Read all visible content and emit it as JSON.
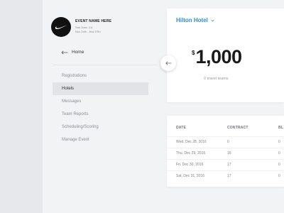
{
  "event": {
    "name": "EVENT NAME HERE",
    "location": "San Jose, CA",
    "dates": "Nov 24th - Nov 27th",
    "logo": "nike-swoosh-logo"
  },
  "sidebar": {
    "home_label": "Home",
    "items": [
      {
        "label": "Registrations",
        "active": false
      },
      {
        "label": "Hotels",
        "active": true
      },
      {
        "label": "Messages",
        "active": false
      },
      {
        "label": "Team Reports",
        "active": false
      },
      {
        "label": "Scheduling/Scoring",
        "active": false
      },
      {
        "label": "Manage Event",
        "active": false
      }
    ]
  },
  "hotel": {
    "name": "Hilton Hotel",
    "currency": "$",
    "amount": "1,000",
    "subtitle": "0 travel teams"
  },
  "table": {
    "columns": [
      "DATE",
      "CONTRACT",
      "BL"
    ],
    "rows": [
      {
        "date": "Wed, Dec 28, 2016",
        "contract": "0",
        "bl": "0"
      },
      {
        "date": "Thu, Dec 29, 2016",
        "contract": "16",
        "bl": "0"
      },
      {
        "date": "Fri, Dec 30, 2016",
        "contract": "17",
        "bl": "0"
      },
      {
        "date": "Sat, Dec 31, 2016",
        "contract": "17",
        "bl": "0"
      }
    ]
  },
  "colors": {
    "accent": "#2d8bd8",
    "active_bg": "#e2e3e7",
    "sidebar_bg": "#f2f3f5"
  }
}
